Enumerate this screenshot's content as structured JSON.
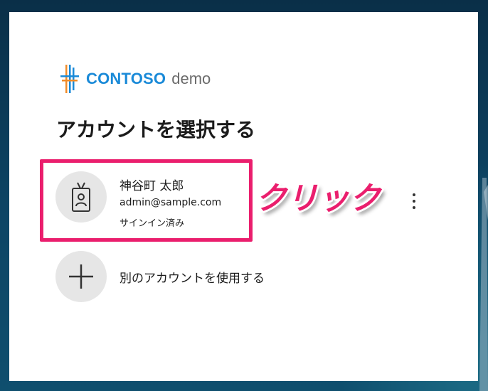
{
  "brand": {
    "name": "CONTOSO",
    "suffix": "demo",
    "colors": {
      "brand_blue": "#1a8ad8",
      "brand_orange": "#f28c28",
      "suffix_gray": "#6b6b6b"
    }
  },
  "page": {
    "title": "アカウントを選択する"
  },
  "account": {
    "name": "神谷町 太郎",
    "email": "admin@sample.com",
    "status": "サインイン済み",
    "icon": "badge-person-icon"
  },
  "annotation": {
    "label": "クリック",
    "color": "#ea1e6d"
  },
  "more_options": {
    "icon": "more-vertical-icon"
  },
  "other_account": {
    "label": "別のアカウントを使用する",
    "icon": "plus-icon"
  }
}
